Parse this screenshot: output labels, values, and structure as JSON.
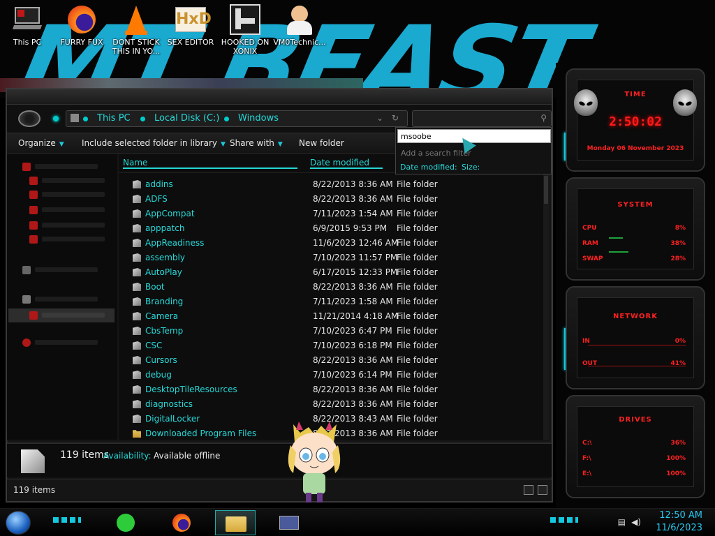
{
  "desktop": {
    "icons": [
      {
        "label": "This PC",
        "icon": "this-pc"
      },
      {
        "label": "FURRY FUX",
        "icon": "firefox"
      },
      {
        "label": "DONT STICK THIS IN YO...",
        "icon": "vlc"
      },
      {
        "label": "SEX EDITOR",
        "icon": "hxd-editor"
      },
      {
        "label": "HOOKED ON XONIX",
        "icon": "xonix-game"
      },
      {
        "label": "VM0Technic...",
        "icon": "doctor-avatar"
      }
    ],
    "wallpaper_text": "MT BEAST"
  },
  "explorer": {
    "breadcrumb": [
      "This PC",
      "Local Disk (C:)",
      "Windows"
    ],
    "toolbar": {
      "organize": "Organize",
      "include": "Include selected folder in library",
      "share": "Share with",
      "new_folder": "New folder"
    },
    "columns": {
      "name": "Name",
      "date": "Date modified"
    },
    "search_popup": {
      "query": "msoobe",
      "add_filter": "Add a search filter",
      "filter1": "Date modified:",
      "filter2": "Size:"
    },
    "files": [
      {
        "name": "addins",
        "date": "8/22/2013 8:36 AM",
        "type": "File folder"
      },
      {
        "name": "ADFS",
        "date": "8/22/2013 8:36 AM",
        "type": "File folder"
      },
      {
        "name": "AppCompat",
        "date": "7/11/2023 1:54 AM",
        "type": "File folder"
      },
      {
        "name": "apppatch",
        "date": "6/9/2015 9:53 PM",
        "type": "File folder"
      },
      {
        "name": "AppReadiness",
        "date": "11/6/2023 12:46 AM",
        "type": "File folder"
      },
      {
        "name": "assembly",
        "date": "7/10/2023 11:57 PM",
        "type": "File folder"
      },
      {
        "name": "AutoPlay",
        "date": "6/17/2015 12:33 PM",
        "type": "File folder"
      },
      {
        "name": "Boot",
        "date": "8/22/2013 8:36 AM",
        "type": "File folder"
      },
      {
        "name": "Branding",
        "date": "7/11/2023 1:58 AM",
        "type": "File folder"
      },
      {
        "name": "Camera",
        "date": "11/21/2014 4:18 AM",
        "type": "File folder"
      },
      {
        "name": "CbsTemp",
        "date": "7/10/2023 6:47 PM",
        "type": "File folder"
      },
      {
        "name": "CSC",
        "date": "7/10/2023 6:18 PM",
        "type": "File folder"
      },
      {
        "name": "Cursors",
        "date": "8/22/2013 8:36 AM",
        "type": "File folder"
      },
      {
        "name": "debug",
        "date": "7/10/2023 6:14 PM",
        "type": "File folder"
      },
      {
        "name": "DesktopTileResources",
        "date": "8/22/2013 8:36 AM",
        "type": "File folder"
      },
      {
        "name": "diagnostics",
        "date": "8/22/2013 8:36 AM",
        "type": "File folder"
      },
      {
        "name": "DigitalLocker",
        "date": "8/22/2013 8:43 AM",
        "type": "File folder"
      },
      {
        "name": "Downloaded Program Files",
        "date": "8/22/2013 8:36 AM",
        "type": "File folder"
      }
    ],
    "details": {
      "count": "119 items",
      "availability_label": "Availability:",
      "availability_value": "Available offline"
    },
    "status": "119 items"
  },
  "gadgets": {
    "time": {
      "title": "TIME",
      "clock": "2:50:02",
      "date": "Monday 06 November 2023"
    },
    "system": {
      "title": "SYSTEM",
      "cpu_label": "CPU",
      "cpu_value": "8%",
      "ram_label": "RAM",
      "ram_value": "38%",
      "swap_label": "SWAP",
      "swap_value": "28%"
    },
    "network": {
      "title": "NETWORK",
      "in_label": "IN",
      "in_value": "0%",
      "out_label": "OUT",
      "out_value": "41%"
    },
    "drives": {
      "title": "DRIVES",
      "c_label": "C:\\",
      "c_value": "36%",
      "f_label": "F:\\",
      "f_value": "100%",
      "e_label": "E:\\",
      "e_value": "100%"
    }
  },
  "taskbar": {
    "time": "12:50 AM",
    "date": "11/6/2023"
  },
  "colors": {
    "accent_cyan": "#24d8d8",
    "gadget_red": "#ff2020"
  }
}
